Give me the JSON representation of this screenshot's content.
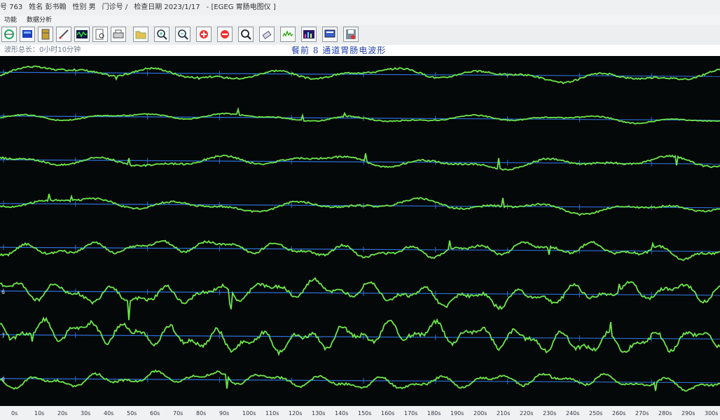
{
  "titlebar": {
    "items": [
      "号 763",
      "姓名 彭书翰",
      "性别 男",
      "门诊号 /",
      "检查日期 2023/1/17",
      "- [EGEG 胃肠电图仪 ]"
    ]
  },
  "menu": {
    "items": [
      "功能",
      "数据分析"
    ]
  },
  "toolbar": {
    "icons": [
      "balance-icon",
      "screen-icon",
      "database-icon",
      "pen-edit-icon",
      "wave-display-icon",
      "document-search-icon",
      "printer-icon",
      "folder-open-icon",
      "zoom-in-icon",
      "zoom-out-icon",
      "plus-icon",
      "minus-icon",
      "magnifier-icon",
      "eraser-icon",
      "spectrum-icon",
      "bar-chart-icon",
      "monitor-icon",
      "save-icon"
    ]
  },
  "info": {
    "duration_label": "波形总长：0小时10分钟",
    "title": "餐前 8 通道胃肠电波形"
  },
  "colors": {
    "trace": "#6ee84a",
    "baseline": "#2f6fd8",
    "background": "#050808"
  },
  "channels": {
    "labels": [
      "",
      "",
      "",
      "",
      "",
      "6",
      "7",
      "8"
    ],
    "amplitudes": [
      0.16,
      0.1,
      0.16,
      0.16,
      0.2,
      0.3,
      0.36,
      0.2
    ],
    "frequencies": [
      1.0,
      1.0,
      1.0,
      1.0,
      1.8,
      2.2,
      2.6,
      2.0
    ]
  },
  "axis": {
    "ticks": [
      "0s",
      "10s",
      "20s",
      "30s",
      "40s",
      "50s",
      "60s",
      "70s",
      "80s",
      "90s",
      "100s",
      "110s",
      "120s",
      "130s",
      "140s",
      "150s",
      "160s",
      "170s",
      "180s",
      "190s",
      "200s",
      "210s",
      "220s",
      "230s",
      "240s",
      "250s",
      "260s",
      "270s",
      "280s",
      "290s",
      "300s"
    ]
  }
}
